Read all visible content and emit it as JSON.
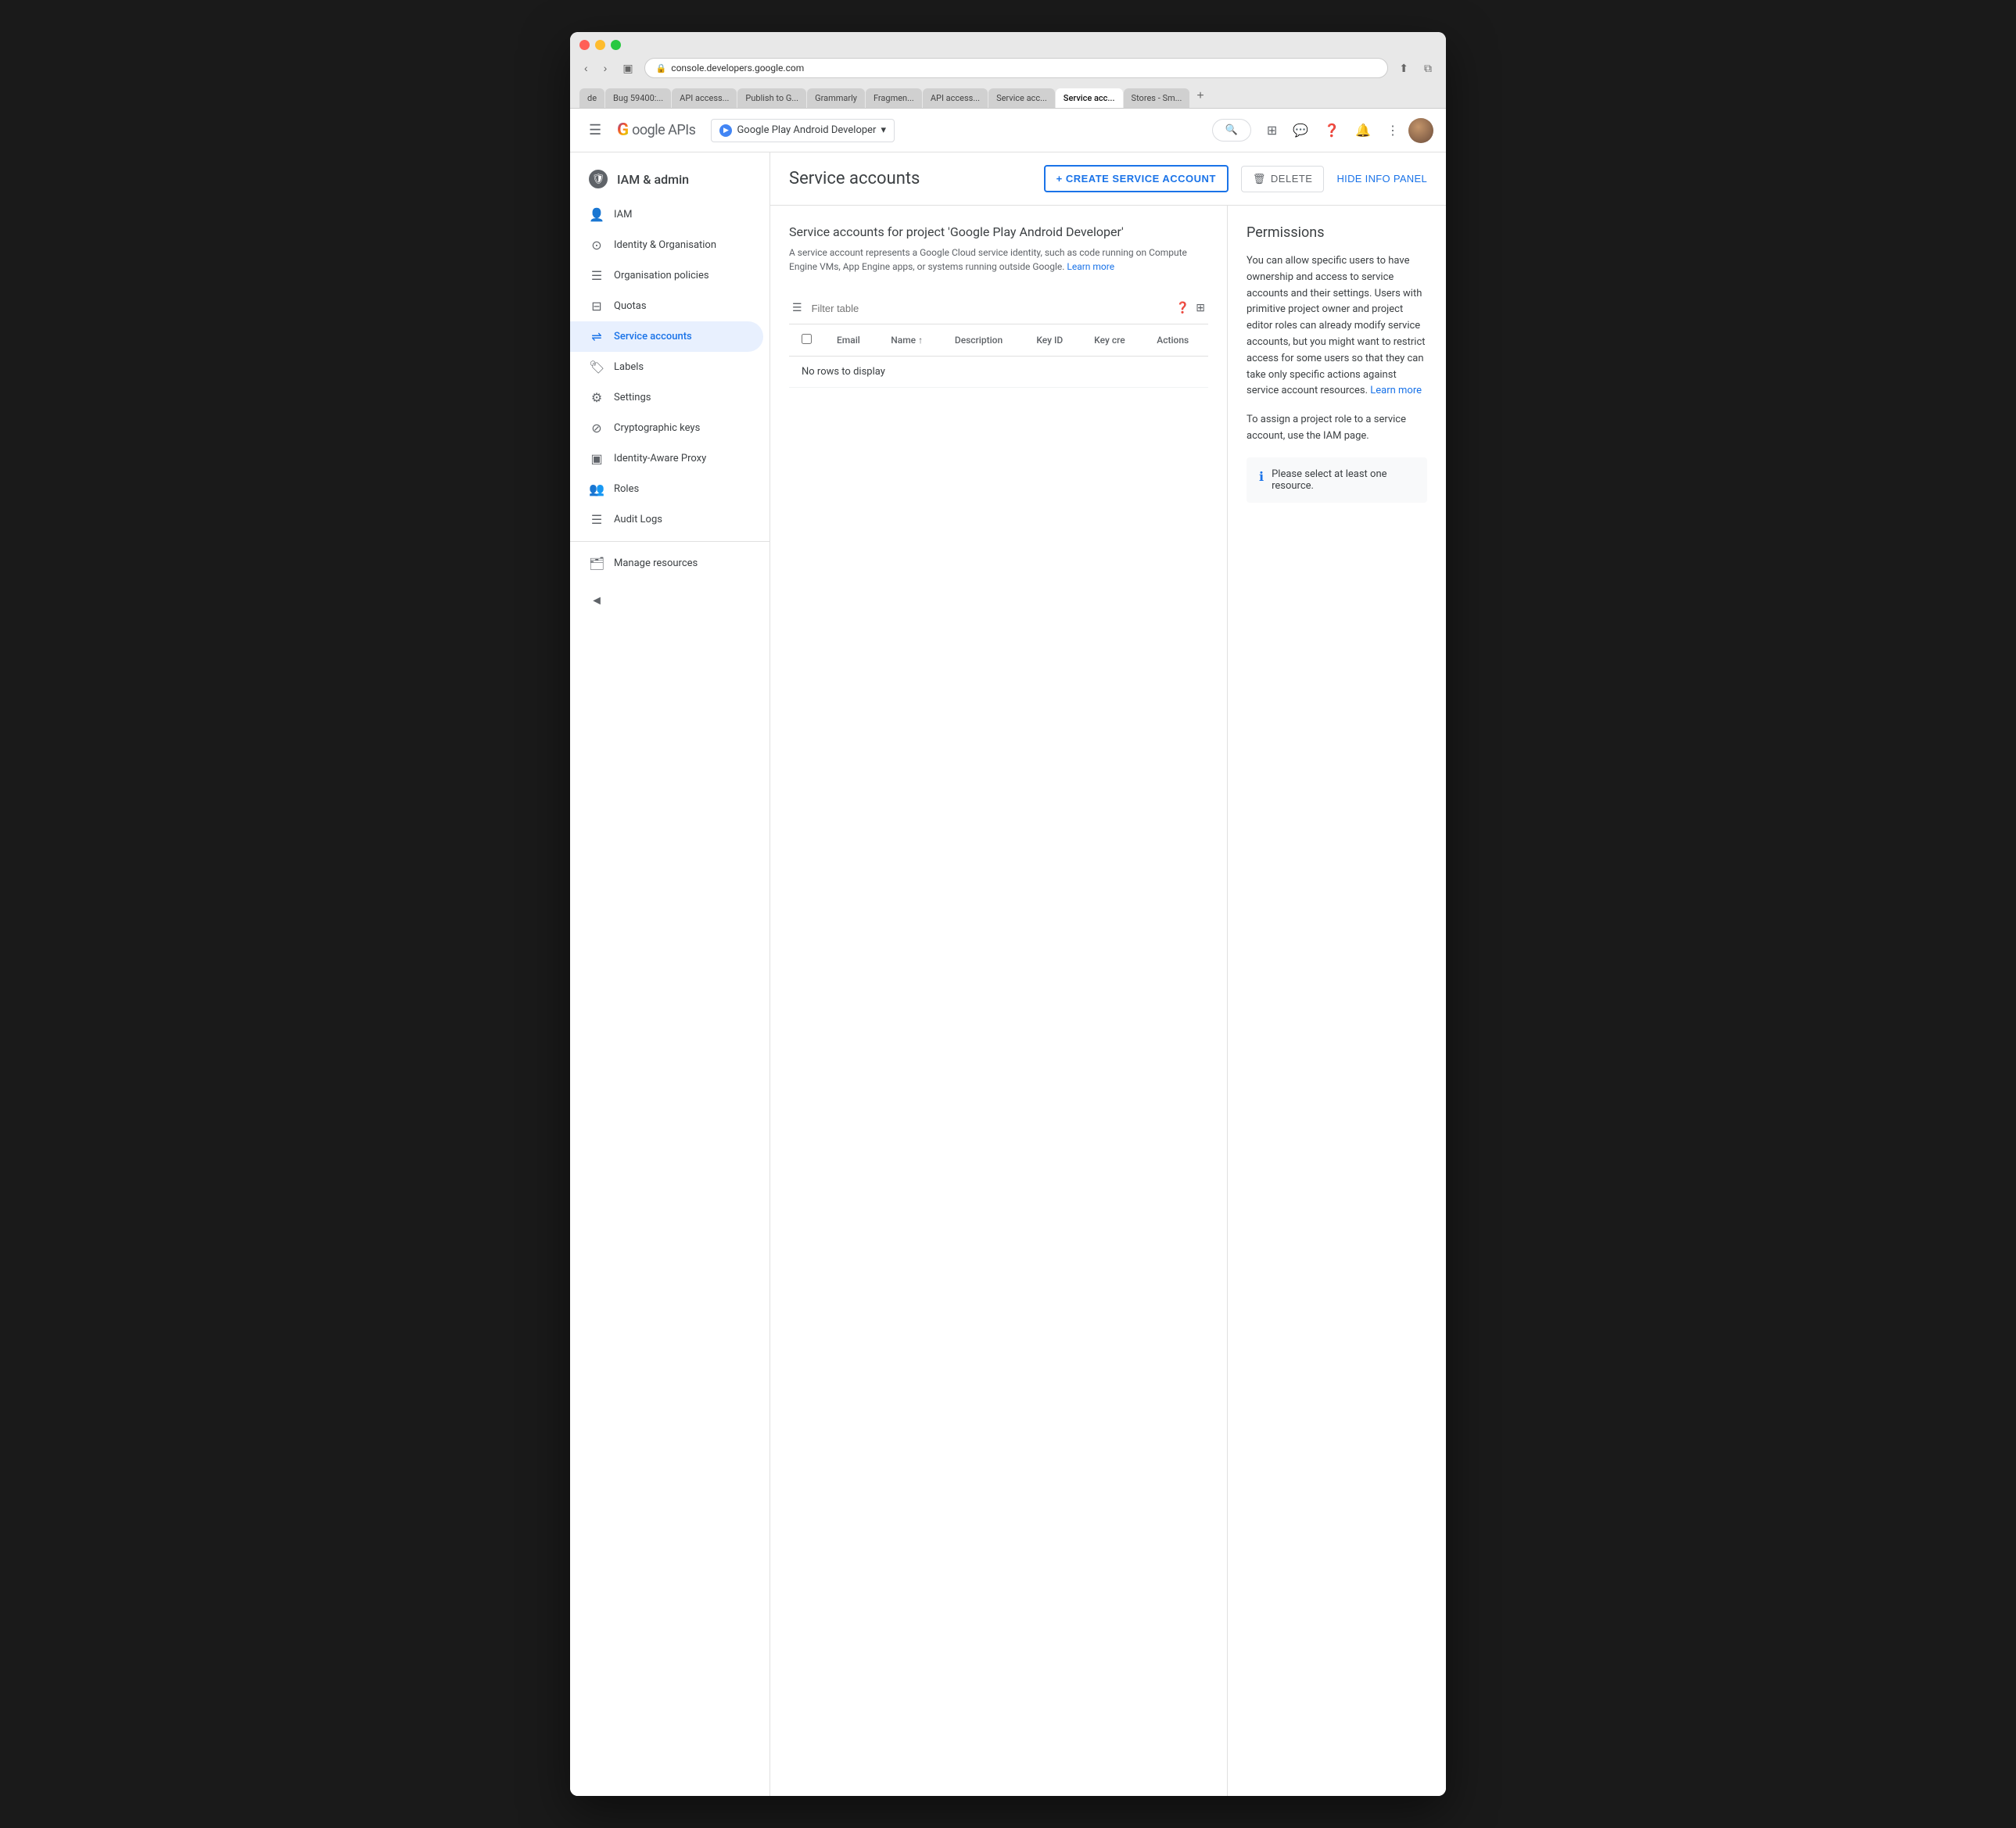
{
  "browser": {
    "url": "console.developers.google.com",
    "tabs": [
      {
        "label": "de",
        "active": false
      },
      {
        "label": "Bug 59400:...",
        "active": false
      },
      {
        "label": "API access...",
        "active": false
      },
      {
        "label": "Publish to G...",
        "active": false
      },
      {
        "label": "Grammarly",
        "active": false
      },
      {
        "label": "Fragmen...",
        "active": false
      },
      {
        "label": "API access...",
        "active": false
      },
      {
        "label": "Service acc...",
        "active": false
      },
      {
        "label": "Service acc...",
        "active": true
      },
      {
        "label": "Stores - Sm...",
        "active": false
      }
    ]
  },
  "topnav": {
    "hamburger_label": "☰",
    "logo_g": "Google",
    "logo_apis": "APIs",
    "project_name": "Google Play Android Developer",
    "search_placeholder": "Search",
    "dropdown_arrow": "▾"
  },
  "sidebar": {
    "header": "IAM & admin",
    "items": [
      {
        "label": "IAM",
        "icon": "👤",
        "id": "iam"
      },
      {
        "label": "Identity & Organisation",
        "icon": "⊙",
        "id": "identity"
      },
      {
        "label": "Organisation policies",
        "icon": "☰",
        "id": "org-policies"
      },
      {
        "label": "Quotas",
        "icon": "⊟",
        "id": "quotas"
      },
      {
        "label": "Service accounts",
        "icon": "⇌",
        "id": "service-accounts",
        "active": true
      },
      {
        "label": "Labels",
        "icon": "🏷",
        "id": "labels"
      },
      {
        "label": "Settings",
        "icon": "⚙",
        "id": "settings"
      },
      {
        "label": "Cryptographic keys",
        "icon": "⊘",
        "id": "crypto-keys"
      },
      {
        "label": "Identity-Aware Proxy",
        "icon": "▣",
        "id": "iap"
      },
      {
        "label": "Roles",
        "icon": "👥",
        "id": "roles"
      },
      {
        "label": "Audit Logs",
        "icon": "☰",
        "id": "audit-logs"
      }
    ],
    "bottom_item": {
      "label": "Manage resources",
      "icon": "🗂",
      "id": "manage-resources"
    },
    "collapse_icon": "◄"
  },
  "header": {
    "page_title": "Service accounts",
    "btn_create": "+ CREATE SERVICE ACCOUNT",
    "btn_delete": "DELETE",
    "btn_hide_panel": "HIDE INFO PANEL"
  },
  "main": {
    "section_title": "Service accounts for project 'Google Play Android Developer'",
    "section_desc": "A service account represents a Google Cloud service identity, such as code running on Compute Engine VMs, App Engine apps, or systems running outside Google.",
    "learn_more_text": "Learn more",
    "filter_placeholder": "Filter table",
    "table_columns": [
      {
        "label": "Email"
      },
      {
        "label": "Name ↑"
      },
      {
        "label": "Description"
      },
      {
        "label": "Key ID"
      },
      {
        "label": "Key cre"
      },
      {
        "label": "Actions"
      }
    ],
    "no_rows_text": "No rows to display"
  },
  "permissions_panel": {
    "title": "Permissions",
    "text1": "You can allow specific users to have ownership and access to service accounts and their settings. Users with primitive project owner and project editor roles can already modify service accounts, but you might want to restrict access for some users so that they can take only specific actions against service account resources.",
    "learn_more_link": "Learn more",
    "text2": "To assign a project role to a service account, use the IAM page.",
    "notice_text": "Please select at least one resource."
  }
}
